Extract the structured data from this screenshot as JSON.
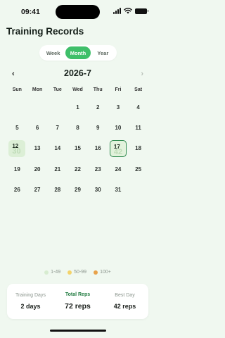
{
  "status_bar": {
    "time": "09:41"
  },
  "header": {
    "title": "Training Records"
  },
  "view_switcher": {
    "options": [
      "Week",
      "Month",
      "Year"
    ],
    "selected": "Month"
  },
  "month_nav": {
    "prev": "‹",
    "title": "2026-7",
    "next": "›"
  },
  "weekdays": [
    "Sun",
    "Mon",
    "Tue",
    "Wed",
    "Thu",
    "Fri",
    "Sat"
  ],
  "calendar": {
    "leading_blanks": 3,
    "days": [
      {
        "day": "1"
      },
      {
        "day": "2"
      },
      {
        "day": "3"
      },
      {
        "day": "4"
      },
      {
        "day": "5"
      },
      {
        "day": "6"
      },
      {
        "day": "7"
      },
      {
        "day": "8"
      },
      {
        "day": "9"
      },
      {
        "day": "10"
      },
      {
        "day": "11"
      },
      {
        "day": "12",
        "reps": "30"
      },
      {
        "day": "13"
      },
      {
        "day": "14"
      },
      {
        "day": "15"
      },
      {
        "day": "16"
      },
      {
        "day": "17",
        "reps": "42",
        "selected": true
      },
      {
        "day": "18"
      },
      {
        "day": "19"
      },
      {
        "day": "20"
      },
      {
        "day": "21"
      },
      {
        "day": "22"
      },
      {
        "day": "23"
      },
      {
        "day": "24"
      },
      {
        "day": "25"
      },
      {
        "day": "26"
      },
      {
        "day": "27"
      },
      {
        "day": "28"
      },
      {
        "day": "29"
      },
      {
        "day": "30"
      },
      {
        "day": "31"
      }
    ]
  },
  "legend": [
    {
      "label": "1-49",
      "color": "#d7ecd0"
    },
    {
      "label": "50-99",
      "color": "#f3d36b"
    },
    {
      "label": "100+",
      "color": "#e8a24a"
    }
  ],
  "stats": {
    "training_days": {
      "label": "Training Days",
      "value": "2 days"
    },
    "total_reps": {
      "label": "Total Reps",
      "value": "72 reps"
    },
    "best_day": {
      "label": "Best Day",
      "value": "42 reps"
    }
  }
}
